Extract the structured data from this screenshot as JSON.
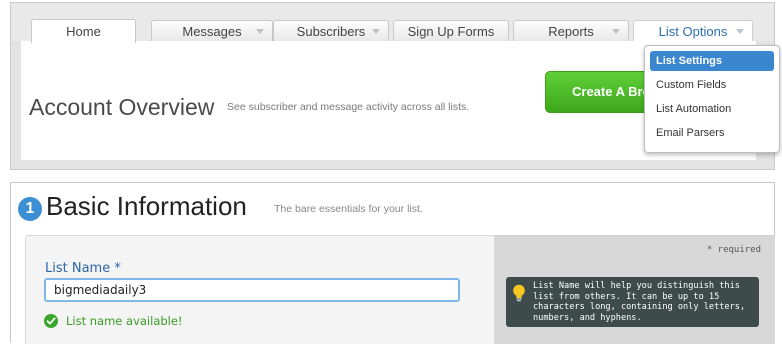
{
  "tabs": [
    {
      "label": "Home",
      "active": true,
      "caret": false
    },
    {
      "label": "Messages",
      "active": false,
      "caret": true
    },
    {
      "label": "Subscribers",
      "active": false,
      "caret": true
    },
    {
      "label": "Sign Up Forms",
      "active": false,
      "caret": false
    },
    {
      "label": "Reports",
      "active": false,
      "caret": true
    },
    {
      "label": "List Options",
      "active": false,
      "caret": true
    }
  ],
  "account": {
    "title": "Account Overview",
    "subtitle": "See subscriber and message activity across all lists.",
    "create_button": "Create A Bro"
  },
  "dropdown": {
    "items": [
      "List Settings",
      "Custom Fields",
      "List Automation",
      "Email Parsers"
    ],
    "selected": "List Settings"
  },
  "basic": {
    "step": "1",
    "title": "Basic Information",
    "subtitle": "The bare essentials for your list.",
    "required_note": "* required",
    "list_name_label": "List Name *",
    "list_name_value": "bigmediadaily3",
    "availability": "List name available!",
    "tooltip": "List Name will help you distinguish this list from others. It can be up to 15 characters long, containing only letters, numbers, and hyphens."
  },
  "colors": {
    "accent_blue": "#3a87d0",
    "create_green": "#4cb925",
    "available_green": "#3a9a24"
  }
}
